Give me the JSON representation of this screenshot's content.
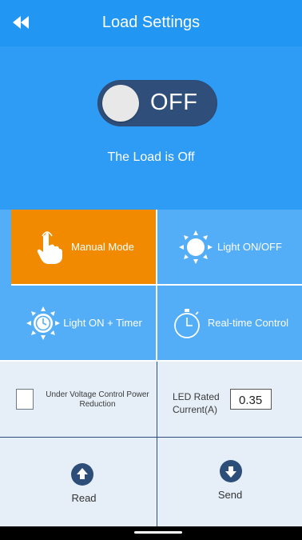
{
  "header": {
    "title": "Load Settings"
  },
  "toggle": {
    "label": "OFF"
  },
  "status": {
    "text": "The Load is Off"
  },
  "modes": [
    {
      "label": "Manual Mode",
      "icon": "hand-tap-icon",
      "active": true
    },
    {
      "label": "Light ON/OFF",
      "icon": "sun-icon",
      "active": false
    },
    {
      "label": "Light ON + Timer",
      "icon": "sun-clock-icon",
      "active": false
    },
    {
      "label": "Real-time Control",
      "icon": "stopwatch-icon",
      "active": false
    }
  ],
  "settings": {
    "under_voltage_label": "Under Voltage Control Power Reduction",
    "under_voltage_checked": false,
    "led_label": "LED Rated Current(A)",
    "led_value": "0.35"
  },
  "actions": {
    "read_label": "Read",
    "send_label": "Send"
  },
  "colors": {
    "primary": "#2196F3",
    "active_mode": "#F28A00",
    "mode_bg": "#53ADF7",
    "toggle_bg": "#2F4F7A"
  }
}
